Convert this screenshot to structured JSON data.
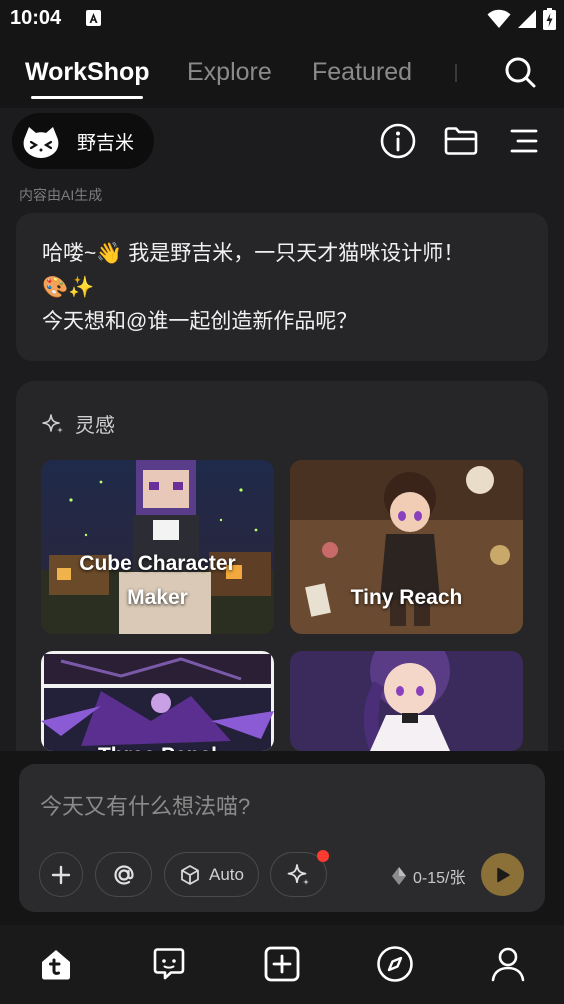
{
  "status_bar": {
    "time": "10:04",
    "icons": [
      "notification-a-icon",
      "wifi-icon",
      "signal-icon",
      "battery-charging-icon"
    ]
  },
  "top_tabs": {
    "items": [
      {
        "label": "WorkShop",
        "active": true
      },
      {
        "label": "Explore",
        "active": false
      },
      {
        "label": "Featured",
        "active": false
      }
    ],
    "search_icon": "search-icon"
  },
  "agent": {
    "name": "野吉米",
    "header_icons": [
      "info-icon",
      "folder-icon",
      "menu-icon"
    ]
  },
  "ai_note": "内容由AI生成",
  "greeting": {
    "line1": "哈喽~👋 我是野吉米，一只天才猫咪设计师！",
    "line2": "🎨✨",
    "line3": "今天想和@谁一起创造新作品呢？"
  },
  "inspiration": {
    "title": "灵感",
    "tiles": [
      {
        "label_line1": "Cube Character",
        "label_line2": "Maker"
      },
      {
        "label_line1": "Tiny Reach",
        "label_line2": ""
      },
      {
        "label_line1": "Three Panel",
        "label_line2": ""
      },
      {
        "label_line1": "",
        "label_line2": ""
      }
    ]
  },
  "composer": {
    "placeholder": "今天又有什么想法喵?",
    "auto_label": "Auto",
    "credits": "0-15/张"
  },
  "colors": {
    "background": "#151515",
    "card": "#262628",
    "send_button": "#8b7138",
    "notification_dot": "#ff3b30"
  },
  "bottom_nav": {
    "items": [
      "home-icon",
      "message-icon",
      "create-icon",
      "compass-icon",
      "profile-icon"
    ]
  }
}
